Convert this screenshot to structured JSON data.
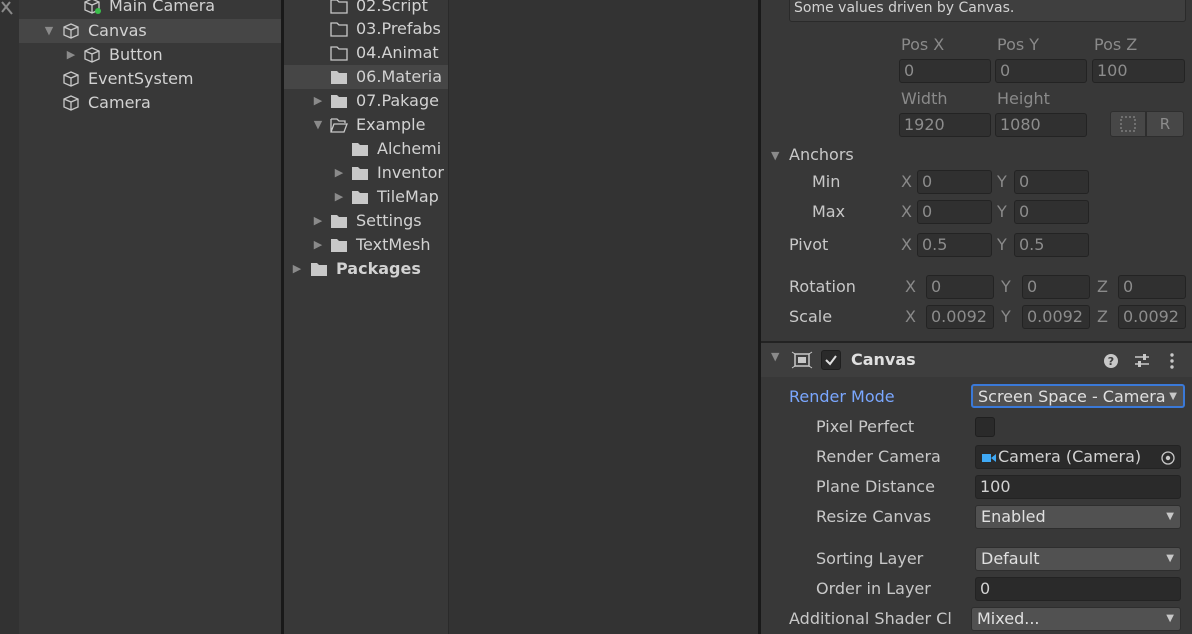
{
  "hierarchy": {
    "items": [
      {
        "label": "Main Camera"
      },
      {
        "label": "Canvas"
      },
      {
        "label": "Button"
      },
      {
        "label": "EventSystem"
      },
      {
        "label": "Camera"
      }
    ]
  },
  "project": {
    "items": [
      {
        "label": "02.Script"
      },
      {
        "label": "03.Prefabs"
      },
      {
        "label": "04.Animat"
      },
      {
        "label": "06.Materia"
      },
      {
        "label": "07.Pakage"
      },
      {
        "label": "Example"
      },
      {
        "label": "Alchemi"
      },
      {
        "label": "Inventor"
      },
      {
        "label": "TileMap"
      },
      {
        "label": "Settings"
      },
      {
        "label": "TextMesh"
      },
      {
        "label": "Packages"
      }
    ]
  },
  "inspector": {
    "rect": {
      "info": "Some values driven by Canvas.",
      "pos_x_label": "Pos X",
      "pos_y_label": "Pos Y",
      "pos_z_label": "Pos Z",
      "pos_x": "0",
      "pos_y": "0",
      "pos_z": "100",
      "width_label": "Width",
      "height_label": "Height",
      "width": "1920",
      "height": "1080",
      "r_button": "R",
      "anchors_label": "Anchors",
      "min_label": "Min",
      "max_label": "Max",
      "x_axis": "X",
      "y_axis": "Y",
      "z_axis": "Z",
      "min_x": "0",
      "min_y": "0",
      "max_x": "0",
      "max_y": "0",
      "pivot_label": "Pivot",
      "pivot_x": "0.5",
      "pivot_y": "0.5",
      "rotation_label": "Rotation",
      "rot_x": "0",
      "rot_y": "0",
      "rot_z": "0",
      "scale_label": "Scale",
      "scale_x": "0.0092",
      "scale_y": "0.0092",
      "scale_z": "0.0092"
    },
    "canvas": {
      "title": "Canvas",
      "render_mode_label": "Render Mode",
      "render_mode": "Screen Space - Camera",
      "pixel_perfect_label": "Pixel Perfect",
      "render_camera_label": "Render Camera",
      "render_camera": "Camera (Camera)",
      "plane_distance_label": "Plane Distance",
      "plane_distance": "100",
      "resize_canvas_label": "Resize Canvas",
      "resize_canvas": "Enabled",
      "sorting_layer_label": "Sorting Layer",
      "sorting_layer": "Default",
      "order_in_layer_label": "Order in Layer",
      "order_in_layer": "0",
      "shader_channels_label": "Additional Shader Cl",
      "shader_channels": "Mixed..."
    }
  },
  "colors": {
    "accent_label": "#7aa7ff",
    "focus": "#3a79d8",
    "selection": "#464646"
  }
}
